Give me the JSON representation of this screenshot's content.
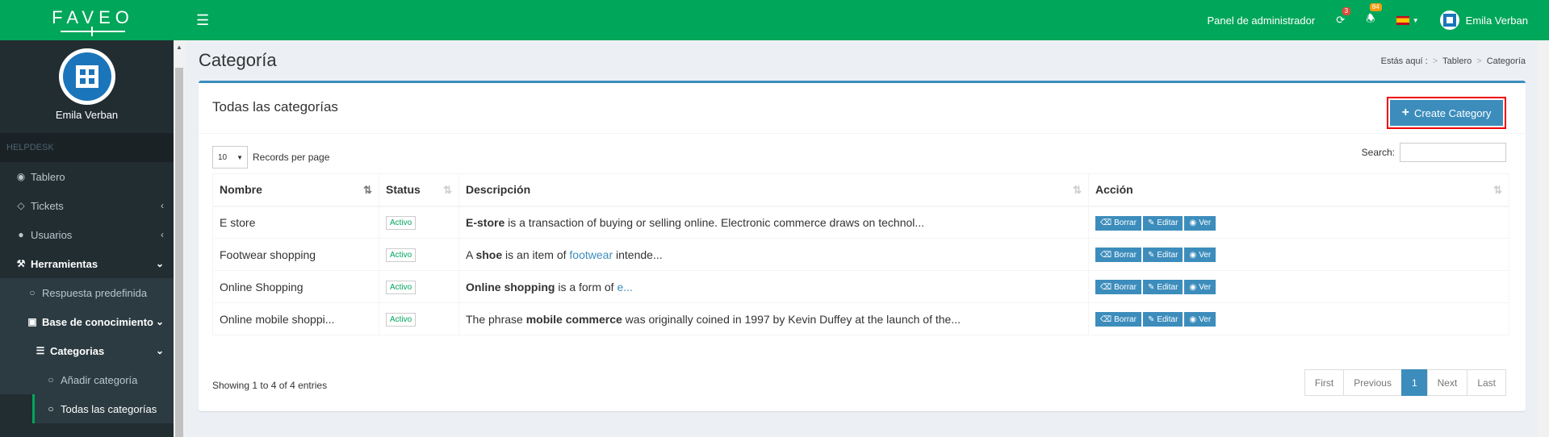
{
  "app": {
    "logo_text": "FAVEO",
    "user_name": "Emila Verban"
  },
  "topbar": {
    "admin_panel": "Panel de administrador",
    "notif_badge_1": "3",
    "notif_badge_2": "84",
    "user_name": "Emila Verban"
  },
  "sidebar": {
    "section_label": "HELPDESK",
    "items": [
      {
        "icon": "dashboard-icon",
        "label": "Tablero"
      },
      {
        "icon": "tag-icon",
        "label": "Tickets"
      },
      {
        "icon": "users-icon",
        "label": "Usuarios"
      },
      {
        "icon": "wrench-icon",
        "label": "Herramientas"
      },
      {
        "icon": "circle-icon",
        "label": "Respuesta predefinida"
      },
      {
        "icon": "book-icon",
        "label": "Base de conocimiento"
      },
      {
        "icon": "list-icon",
        "label": "Categorias"
      },
      {
        "icon": "circle-icon",
        "label": "Añadir categoría"
      },
      {
        "icon": "circle-icon",
        "label": "Todas las categorías"
      }
    ]
  },
  "page": {
    "title": "Categoría",
    "breadcrumb": {
      "prefix": "Estás aquí :",
      "items": [
        "Tablero",
        "Categoría"
      ]
    }
  },
  "box": {
    "title": "Todas las categorías",
    "create_button": "Create Category",
    "length_value": "10",
    "length_label": "Records per page",
    "search_label": "Search:",
    "search_value": ""
  },
  "table": {
    "columns": [
      "Nombre",
      "Status",
      "Descripción",
      "Acción"
    ],
    "rows": [
      {
        "name": "E store",
        "status": "Activo",
        "desc_bold": "E-store",
        "desc_rest": " is a transaction of buying or selling online. Electronic commerce draws on technol..."
      },
      {
        "name": "Footwear shopping",
        "status": "Activo",
        "desc_pre": "A ",
        "desc_bold": "shoe",
        "desc_mid": " is an item of ",
        "desc_link": "footwear",
        "desc_rest": " intende..."
      },
      {
        "name": "Online Shopping",
        "status": "Activo",
        "desc_bold": "Online shopping",
        "desc_mid": " is a form of ",
        "desc_link": "e..."
      },
      {
        "name": "Online mobile shoppi...",
        "status": "Activo",
        "desc_pre": "The phrase ",
        "desc_bold": "mobile commerce",
        "desc_rest": " was originally coined in 1997 by Kevin Duffey at the launch of the..."
      }
    ],
    "actions": {
      "delete": "Borrar",
      "edit": "Editar",
      "view": "Ver"
    }
  },
  "footer": {
    "info": "Showing 1 to 4 of 4 entries",
    "pager": [
      "First",
      "Previous",
      "1",
      "Next",
      "Last"
    ]
  },
  "colors": {
    "brand_green": "#00a65a",
    "primary_blue": "#3c8dbc",
    "sidebar_dark": "#222d32"
  }
}
